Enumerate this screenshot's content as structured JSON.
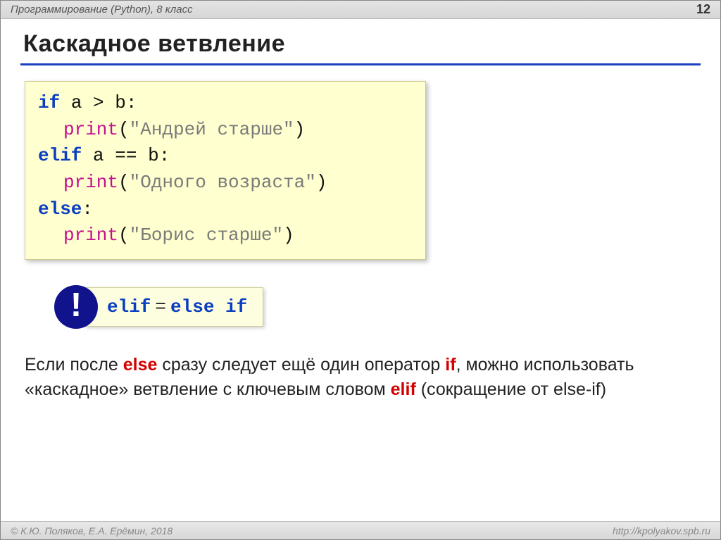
{
  "header": {
    "left": "Программирование (Python), 8 класс",
    "page": "12"
  },
  "title": "Каскадное ветвление",
  "code": {
    "if": "if",
    "elif": "elif",
    "else": "else",
    "print": "print",
    "cond1_left": "a",
    "cond1_op": ">",
    "cond1_right": "b",
    "cond2_left": "a",
    "cond2_op": "==",
    "cond2_right": "b",
    "str1": "\"Андрей старше\"",
    "str2": "\"Одного возраста\"",
    "str3": "\"Борис старше\"",
    "colon": ":",
    "lp": "(",
    "rp": ")"
  },
  "note": {
    "bang": "!",
    "lhs": "elif",
    "eq": "=",
    "rhs": "else if"
  },
  "para": {
    "t1": "Если после ",
    "else": "else",
    "t2": " сразу следует ещё один оператор ",
    "if": "if",
    "t3": ", можно использовать «каскадное» ветвление с ключевым словом ",
    "elif": "elif",
    "t4": " (сокращение от else-if)"
  },
  "footer": {
    "left": "© К.Ю. Поляков, Е.А. Ерёмин, 2018",
    "right": "http://kpolyakov.spb.ru"
  }
}
